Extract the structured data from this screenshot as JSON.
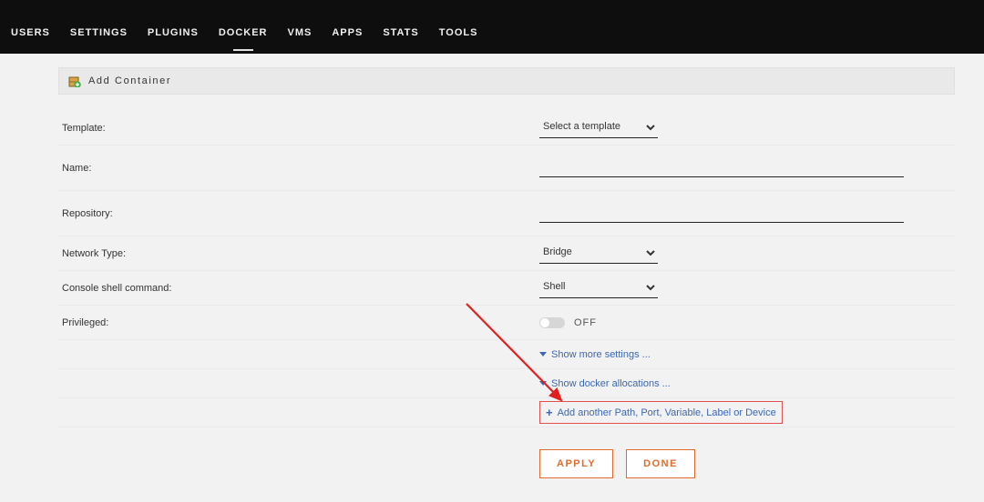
{
  "nav": {
    "items": [
      {
        "label": "USERS"
      },
      {
        "label": "SETTINGS"
      },
      {
        "label": "PLUGINS"
      },
      {
        "label": "DOCKER",
        "active": true
      },
      {
        "label": "VMS"
      },
      {
        "label": "APPS"
      },
      {
        "label": "STATS"
      },
      {
        "label": "TOOLS"
      }
    ]
  },
  "page": {
    "title": "Add Container",
    "icon": "box-add-icon"
  },
  "form": {
    "template_label": "Template:",
    "template_value": "Select a template",
    "name_label": "Name:",
    "name_value": "",
    "repository_label": "Repository:",
    "repository_value": "",
    "network_label": "Network Type:",
    "network_value": "Bridge",
    "console_label": "Console shell command:",
    "console_value": "Shell",
    "privileged_label": "Privileged:",
    "privileged_toggle_state": "OFF"
  },
  "links": {
    "show_more": "Show more settings ...",
    "show_alloc": "Show docker allocations ...",
    "add_another": "Add another Path, Port, Variable, Label or Device"
  },
  "actions": {
    "apply": "APPLY",
    "done": "DONE"
  },
  "colors": {
    "accent": "#e26a2c",
    "link": "#3b67b3",
    "highlight_box": "#e05050"
  }
}
